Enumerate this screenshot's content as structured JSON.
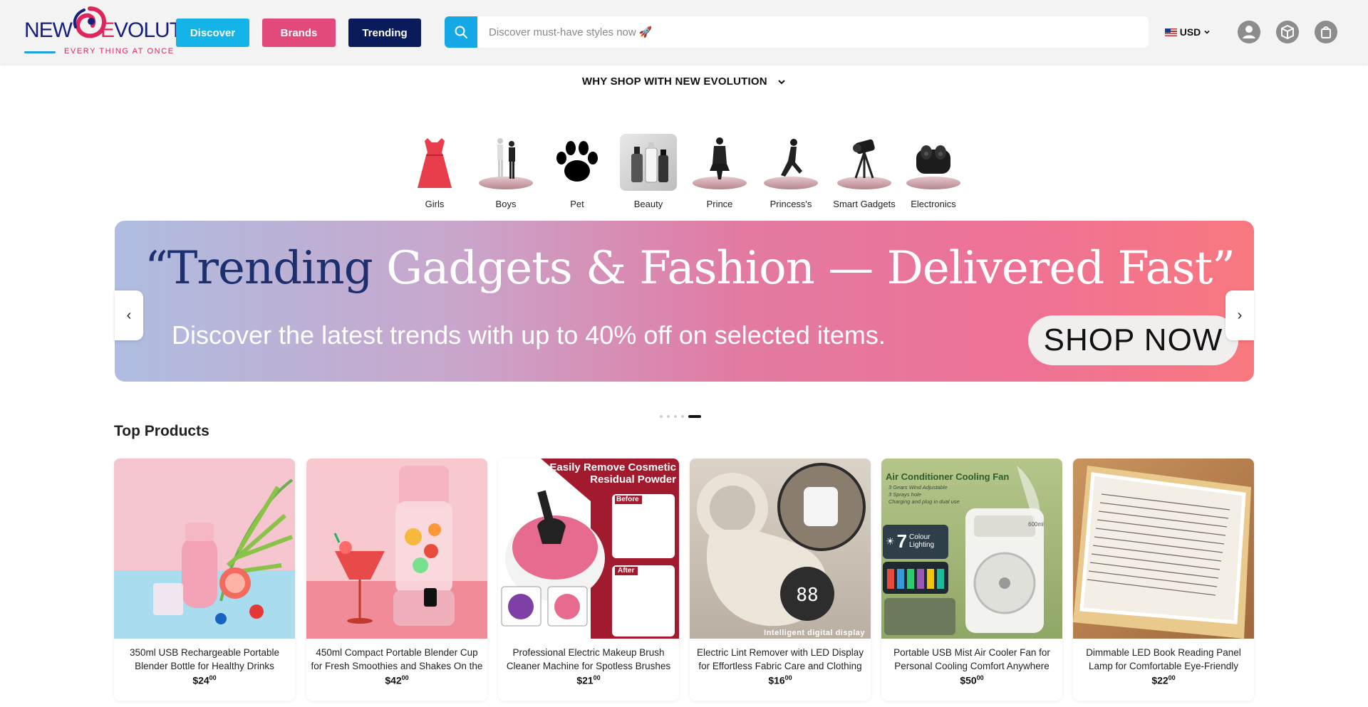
{
  "header": {
    "logo_text": "NEW EVOLUTION",
    "logo_tagline": "EVERY THING AT ONCE",
    "nav": {
      "discover": "Discover",
      "brands": "Brands",
      "trending": "Trending"
    },
    "search_placeholder": "Discover must-have styles now 🚀",
    "currency": "USD",
    "icons": [
      "account-icon",
      "orders-box-icon",
      "cart-icon"
    ]
  },
  "why_shop": "WHY SHOP WITH NEW EVOLUTION",
  "categories": [
    {
      "label": "Girls",
      "icon": "dress-icon"
    },
    {
      "label": "Boys",
      "icon": "boys-figure-icon"
    },
    {
      "label": "Pet",
      "icon": "paw-icon"
    },
    {
      "label": "Beauty",
      "icon": "cosmetics-icon"
    },
    {
      "label": "Prince",
      "icon": "prince-figure-icon"
    },
    {
      "label": "Princess's",
      "icon": "princess-figure-icon"
    },
    {
      "label": "Smart Gadgets",
      "icon": "gadget-icon"
    },
    {
      "label": "Electronics",
      "icon": "earbuds-icon"
    }
  ],
  "banner": {
    "title_part1": "“Trending",
    "title_part2": "Gadgets & Fashion — Delivered Fast”",
    "subtitle": "Discover the latest trends with up to 40% off on selected items.",
    "cta": "SHOP NOW",
    "prev": "‹",
    "next": "›"
  },
  "carousel": {
    "slide_count": 5,
    "active_slide": 5
  },
  "top_products": {
    "title": "Top Products",
    "items": [
      {
        "name": "350ml USB Rechargeable Portable Blender Bottle for Healthy Drinks",
        "price_main": "$24",
        "price_cents": "00"
      },
      {
        "name": "450ml Compact Portable Blender Cup for Fresh Smoothies and Shakes On the",
        "price_main": "$42",
        "price_cents": "00"
      },
      {
        "name": "Professional Electric Makeup Brush Cleaner Machine for Spotless Brushes",
        "price_main": "$21",
        "price_cents": "00"
      },
      {
        "name": "Electric Lint Remover with LED Display for Effortless Fabric Care and Clothing",
        "price_main": "$16",
        "price_cents": "00"
      },
      {
        "name": "Portable USB Mist Air Cooler Fan for Personal Cooling Comfort Anywhere",
        "price_main": "$50",
        "price_cents": "00"
      },
      {
        "name": "Dimmable LED Book Reading Panel Lamp for Comfortable Eye-Friendly",
        "price_main": "$22",
        "price_cents": "00"
      }
    ]
  },
  "product_image_text": {
    "brush_cleaner_headline": "Easily Remove Cosmetic Residual Powder",
    "before": "Before",
    "after": "After",
    "lint_caption": "Intelligent digital display",
    "fan_headline": "Air Conditioner Cooling Fan",
    "fan_lines": [
      "3 Gears Wind Adjustable",
      "3 Sprays hole",
      "Charging and plug in dual use"
    ],
    "fan_badge_number": "7",
    "fan_badge_text": "Colour Lighting",
    "fan_capacity": "600ml"
  }
}
